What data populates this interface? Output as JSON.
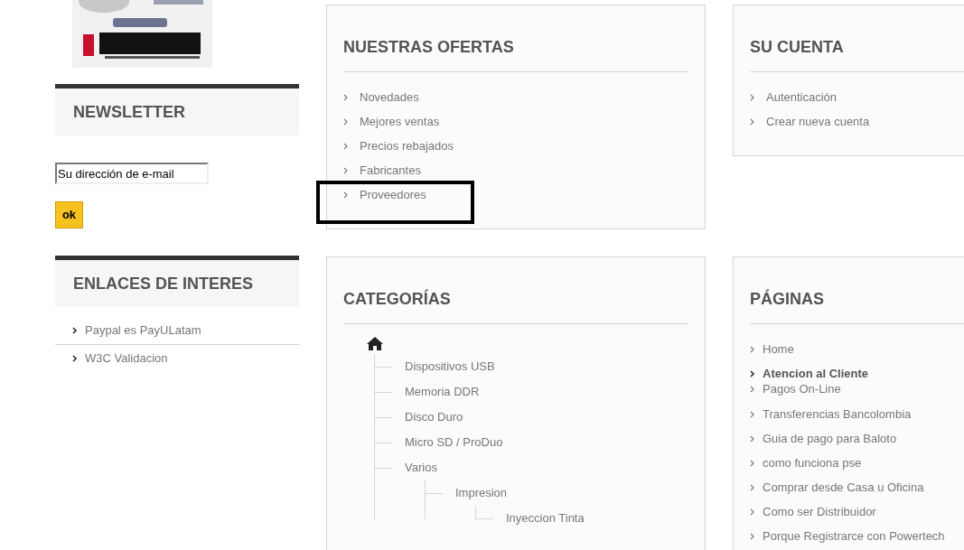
{
  "sidebar": {
    "newsletter": {
      "title": "NEWSLETTER",
      "email_field": {
        "value": "Su dirección de e-mail"
      },
      "submit_button": "ok"
    },
    "links": {
      "title": "ENLACES DE INTERES",
      "items": [
        {
          "label": "Paypal es PayULatam"
        },
        {
          "label": "W3C Validacion"
        }
      ]
    }
  },
  "offers": {
    "title": "NUESTRAS OFERTAS",
    "items": [
      {
        "label": "Novedades",
        "highlighted": false
      },
      {
        "label": "Mejores ventas",
        "highlighted": false
      },
      {
        "label": "Precios rebajados",
        "highlighted": false
      },
      {
        "label": "Fabricantes",
        "highlighted": false
      },
      {
        "label": "Proveedores",
        "highlighted": true
      }
    ]
  },
  "account": {
    "title": "SU CUENTA",
    "items": [
      {
        "label": "Autenticación"
      },
      {
        "label": "Crear nueva cuenta"
      }
    ]
  },
  "categories": {
    "title": "CATEGORÍAS",
    "tree": {
      "children": [
        {
          "label": "Dispositivos USB"
        },
        {
          "label": "Memoria DDR"
        },
        {
          "label": "Disco Duro"
        },
        {
          "label": "Micro SD / ProDuo"
        },
        {
          "label": "Varios",
          "children": [
            {
              "label": "Impresion",
              "children": [
                {
                  "label": "Inyeccion Tinta"
                }
              ]
            }
          ]
        }
      ]
    }
  },
  "pages": {
    "title": "PÁGINAS",
    "items": [
      {
        "label": "Home",
        "kind": "link"
      },
      {
        "label": "Atencion al Cliente",
        "kind": "heading"
      },
      {
        "label": "Pagos On-Line",
        "kind": "link"
      },
      {
        "label": "Transferencias Bancolombia",
        "kind": "link"
      },
      {
        "label": "Guia de pago para Baloto",
        "kind": "link"
      },
      {
        "label": "como funciona pse",
        "kind": "link"
      },
      {
        "label": "Comprar desde Casa u Oficina",
        "kind": "link"
      },
      {
        "label": "Como ser Distribuidor",
        "kind": "link"
      },
      {
        "label": "Porque Registrarce con Powertech",
        "kind": "link"
      }
    ]
  }
}
